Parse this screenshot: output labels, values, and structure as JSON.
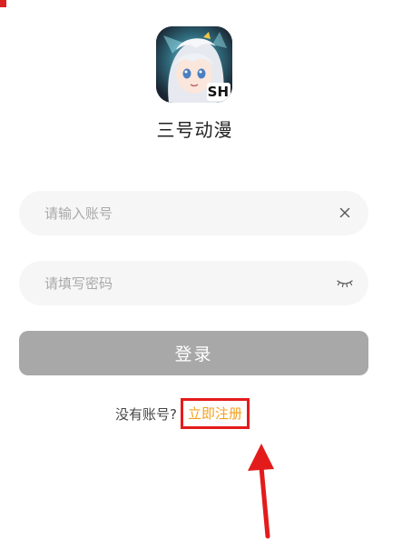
{
  "app": {
    "name": "三号动漫",
    "logo_badge": "SH",
    "logo_icon": "anime-girl-avatar"
  },
  "login_form": {
    "account_placeholder": "请输入账号",
    "account_value": "",
    "account_clear_icon": "close-icon",
    "password_placeholder": "请填写密码",
    "password_value": "",
    "password_toggle_icon": "closed-eye-icon",
    "login_label": "登录"
  },
  "register": {
    "prompt": "没有账号?",
    "link_label": "立即注册"
  },
  "colors": {
    "accent": "#f3a11e",
    "highlight_box": "#e41b1b",
    "button_disabled": "#a8a8a8",
    "field_background": "#f6f6f6"
  }
}
